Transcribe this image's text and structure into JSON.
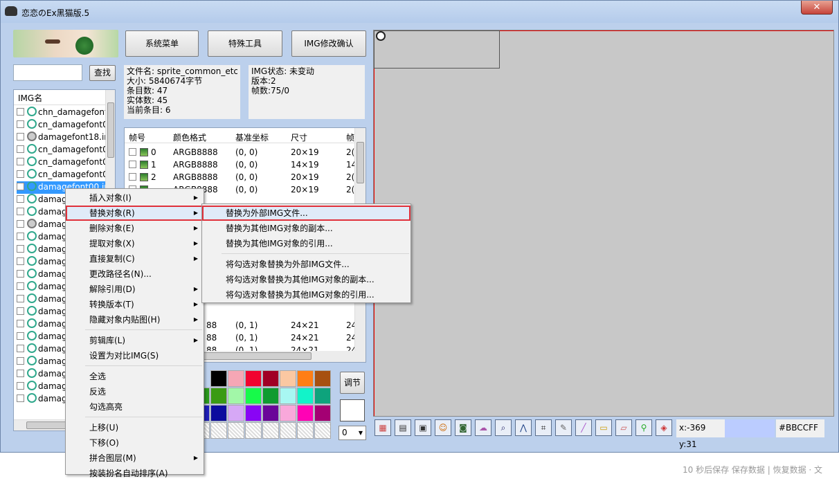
{
  "window": {
    "title": "恋恋のEx黑猫版.5",
    "close_glyph": "✕"
  },
  "search": {
    "button": "查找",
    "value": ""
  },
  "top_buttons": {
    "system_menu": "系统菜单",
    "special_tools": "特殊工具",
    "img_confirm": "IMG修改确认"
  },
  "file_info": {
    "filename": "文件名: sprite_common_etc",
    "size": "大小: 5840674字节",
    "entries": "条目数: 47",
    "entities": "实体数: 45",
    "current": "当前条目: 6"
  },
  "img_info": {
    "state": "IMG状态: 未变动",
    "version": "版本:2",
    "frames": "帧数:75/0"
  },
  "img_list": {
    "header": "IMG名",
    "items": [
      "chn_damagefont",
      "cn_damagefont0",
      "damagefont18.ir",
      "cn_damagefont0",
      "cn_damagefont0",
      "cn_damagefont0",
      "damagefont00.ir",
      "damag",
      "damag",
      "damag",
      "damag",
      "damag",
      "damag",
      "damag",
      "damag",
      "damag",
      "damag",
      "damag",
      "damag",
      "damag",
      "damag",
      "damag",
      "damag",
      "damag"
    ]
  },
  "frame_table": {
    "headers": [
      "帧号",
      "颜色格式",
      "基准坐标",
      "尺寸",
      "帧"
    ],
    "rows": [
      {
        "n": "0",
        "fmt": "ARGB8888",
        "pos": "(0, 0)",
        "size": "20×19",
        "x": "2("
      },
      {
        "n": "1",
        "fmt": "ARGB8888",
        "pos": "(0, 0)",
        "size": "14×19",
        "x": "14"
      },
      {
        "n": "2",
        "fmt": "ARGB8888",
        "pos": "(0, 0)",
        "size": "20×19",
        "x": "2("
      },
      {
        "n": "",
        "fmt": "ARGB8888",
        "pos": "(0, 0)",
        "size": "20×19",
        "x": "2("
      }
    ],
    "rows_lower": [
      {
        "fmt": "88",
        "pos": "(0, 1)",
        "size": "24×21",
        "x": "24"
      },
      {
        "fmt": "88",
        "pos": "(0, 1)",
        "size": "24×21",
        "x": "24"
      },
      {
        "fmt": "88",
        "pos": "(0, 1)",
        "size": "24×21",
        "x": "24"
      }
    ]
  },
  "context_menu": {
    "items": [
      "插入对象(I)",
      "替换对象(R)",
      "删除对象(E)",
      "提取对象(X)",
      "直接复制(C)",
      "更改路径名(N)...",
      "解除引用(D)",
      "转换版本(T)",
      "隐藏对象内贴图(H)",
      "剪辑库(L)",
      "设置为对比IMG(S)",
      "全选",
      "反选",
      "勾选高亮",
      "上移(U)",
      "下移(O)",
      "拼合图层(M)",
      "按装扮名自动排序(A)"
    ]
  },
  "submenu": {
    "items": [
      "替换为外部IMG文件...",
      "替换为其他IMG对象的副本...",
      "替换为其他IMG对象的引用...",
      "将勾选对象替换为外部IMG文件...",
      "将勾选对象替换为其他IMG对象的副本...",
      "将勾选对象替换为其他IMG对象的引用..."
    ]
  },
  "palette": {
    "adjust": "调节",
    "select_value": "0",
    "colors": [
      "#000000",
      "#f6a7b5",
      "#f1032f",
      "#a10025",
      "#fbc8a2",
      "#ff7e15",
      "#a75010",
      "#2a9a1c",
      "#3a9b14",
      "#a2f7a8",
      "#17fa4a",
      "#0f9b30",
      "#a8f7f2",
      "#12f3c9",
      "#0ea37c",
      "#1e1eba",
      "#0c0c9e",
      "#d6a8f6",
      "#8905f5",
      "#6a0599",
      "#f9a8db",
      "#ff02b5",
      "#a40073"
    ]
  },
  "toolbar": {
    "coords": "x:-369 y:31",
    "color_hex": "#BBCCFF",
    "color_swatch": "#BBCCFF"
  },
  "status_bar": {
    "text": "10 秒后保存 保存数据 | 恢复数据 · 文"
  }
}
